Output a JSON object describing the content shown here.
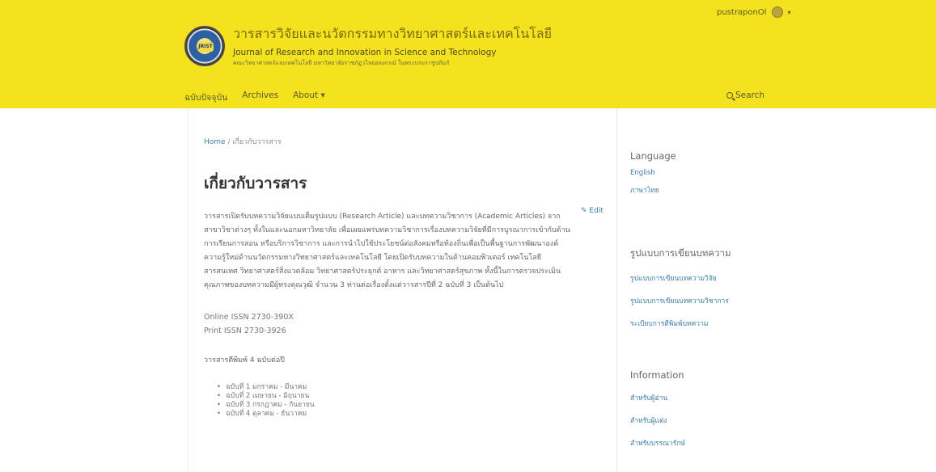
{
  "header": {
    "title_thai": "วารสารวิจัยและนวัตกรรมทางวิทยาศาสตร์และเทคโนโลยี",
    "title_en": "Journal of Research and Innovation in Science and Technology",
    "subtitle": "คณะวิทยาศาสตร์และเทคโนโลยี มหาวิทยาลัยราชภัฏวไลยอลงกรณ์ ในพระบรมราชูปถัมภ์",
    "logo_text": "JRIST",
    "user": "pustraponOl",
    "colors": {
      "header_bg": "#f4e21e",
      "link": "#3b7fa8"
    }
  },
  "nav": {
    "items": [
      "ฉบับปัจจุบัน",
      "Archives",
      "About ▾"
    ],
    "search_label": "Search"
  },
  "main": {
    "breadcrumb": {
      "home": "Home",
      "separator": "/",
      "current": "เกี่ยวกับวารสาร"
    },
    "page_title": "เกี่ยวกับวารสาร",
    "edit_label": "Edit",
    "intro": "วารสารเปิดรับบทความวิจัยแบบเต็มรูปแบบ (Research Article) และบทความวิชาการ (Academic Articles) จากสาขาวิชาต่างๆ ทั้งในและนอกมหาวิทยาลัย เพื่อเผยแพร่บทความวิชาการเรื่องบทความวิจัยที่มีการบูรณาการเข้ากับด้านการเรียนการสอน หรือบริการวิชาการ และการนำไปใช้ประโยชน์ต่อสังคมหรือท้องถิ่นเพื่อเป็นพื้นฐานการพัฒนาองค์ความรู้ใหม่ด้านนวัตกรรมทางวิทยาศาสตร์และเทคโนโลยี โดยเปิดรับบทความในด้านคอมพิวเตอร์ เทคโนโลยีสารสนเทศ วิทยาศาสตร์สิ่งแวดล้อม วิทยาศาสตร์ประยุกต์ อาหาร และวิทยาศาสตร์สุขภาพ ทั้งนี้ในการตรวจประเมินคุณภาพของบทความมีผู้ทรงคุณวุฒิ จำนวน 3 ท่านต่อเรื่องตั้งแต่วารสารปีที่ 2 ฉบับที่ 3 เป็นต้นไป",
    "issn_online": "Online ISSN 2730-390X",
    "issn_print": "Print ISSN 2730-3926",
    "pub_freq": "วารสารตีพิมพ์ 4 ฉบับต่อปี",
    "issues": [
      "ฉบับที่ 1 มกราคม - มีนาคม",
      "ฉบับที่ 2 เมษายน - มิถุนายน",
      "ฉบับที่ 3 กรกฎาคม - กันยายน",
      "ฉบับที่ 4 ตุลาคม - ธันวาคม"
    ]
  },
  "sidebar": {
    "language": {
      "heading": "Language",
      "items": [
        "English",
        "ภาษาไทย"
      ]
    },
    "templates": {
      "heading": "รูปแบบการเขียนบทความ",
      "items": [
        "รูปแบบการเขียนบทความวิจัย",
        "รูปแบบการเขียนบทความวิชาการ",
        "ระเบียบการตีพิมพ์บทความ"
      ]
    },
    "information": {
      "heading": "Information",
      "items": [
        "สำหรับผู้อ่าน",
        "สำหรับผู้แต่ง",
        "สำหรับบรรณารักษ์"
      ]
    }
  }
}
